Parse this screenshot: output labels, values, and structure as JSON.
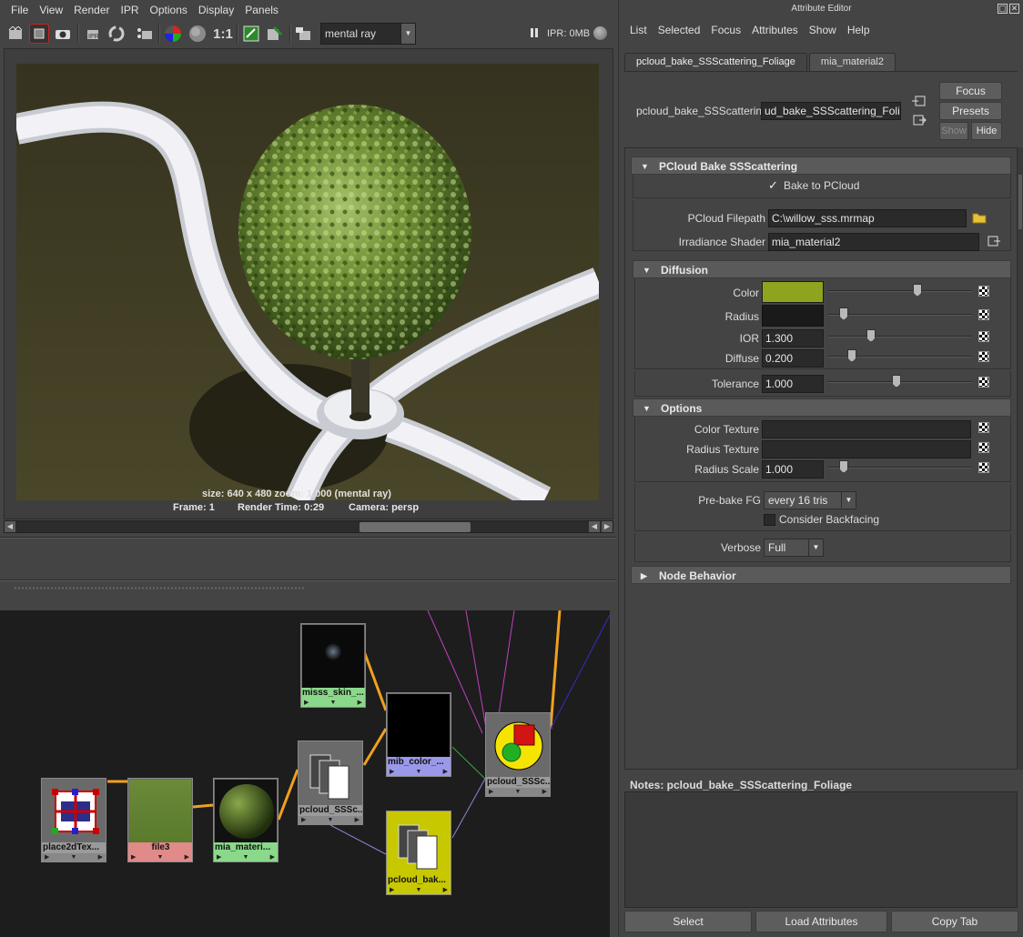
{
  "render_view": {
    "menu": [
      "File",
      "View",
      "Render",
      "IPR",
      "Options",
      "Display",
      "Panels"
    ],
    "toolbar": {
      "ratio_label": "1:1",
      "renderer": "mental ray",
      "ipr_status": "IPR: 0MB"
    },
    "caption": "size: 640 x 480 zoom: 1.000     (mental ray)",
    "frame_label": "Frame: 1",
    "render_time": "Render Time: 0:29",
    "camera": "Camera: persp"
  },
  "hypershade": {
    "nodes": [
      {
        "id": "place2d",
        "label": "place2dTex..."
      },
      {
        "id": "file3",
        "label": "file3"
      },
      {
        "id": "mia_material",
        "label": "mia_materi..."
      },
      {
        "id": "misss_skin",
        "label": "misss_skin_..."
      },
      {
        "id": "pcloud_sss_mid",
        "label": "pcloud_SSSc..."
      },
      {
        "id": "mib_color",
        "label": "mib_color_..."
      },
      {
        "id": "pcloud_bake",
        "label": "pcloud_bak..."
      },
      {
        "id": "pcloud_sss_sg",
        "label": "pcloud_SSSc..."
      }
    ]
  },
  "attribute_editor": {
    "title": "Attribute Editor",
    "menu": [
      "List",
      "Selected",
      "Focus",
      "Attributes",
      "Show",
      "Help"
    ],
    "tabs": [
      "pcloud_bake_SSScattering_Foliage",
      "mia_material2"
    ],
    "node_type_label": "pcloud_bake_SSScattering:",
    "node_name_value": "ud_bake_SSScattering_Foliage",
    "buttons": {
      "focus": "Focus",
      "presets": "Presets",
      "show": "Show",
      "hide": "Hide"
    },
    "sections": {
      "main": {
        "title": "PCloud Bake SSScattering",
        "bake_to_pcloud": "Bake to PCloud",
        "filepath_label": "PCloud Filepath",
        "filepath_value": "C:\\willow_sss.mrmap",
        "irradiance_label": "Irradiance Shader",
        "irradiance_value": "mia_material2"
      },
      "diffusion": {
        "title": "Diffusion",
        "color_label": "Color",
        "color_value": "#8ea41e",
        "radius_label": "Radius",
        "radius_color": "#1a1a1a",
        "ior_label": "IOR",
        "ior_value": "1.300",
        "diffuse_label": "Diffuse",
        "diffuse_value": "0.200",
        "tolerance_label": "Tolerance",
        "tolerance_value": "1.000"
      },
      "options": {
        "title": "Options",
        "color_texture_label": "Color Texture",
        "radius_texture_label": "Radius Texture",
        "radius_scale_label": "Radius Scale",
        "radius_scale_value": "1.000",
        "prebake_label": "Pre-bake FG",
        "prebake_value": "every 16 tris",
        "backfacing_label": "Consider Backfacing",
        "verbose_label": "Verbose",
        "verbose_value": "Full"
      },
      "node_behavior": {
        "title": "Node Behavior"
      }
    },
    "notes_label": "Notes:  pcloud_bake_SSScattering_Foliage",
    "bottom_buttons": {
      "select": "Select",
      "load": "Load Attributes",
      "copy": "Copy Tab"
    }
  }
}
